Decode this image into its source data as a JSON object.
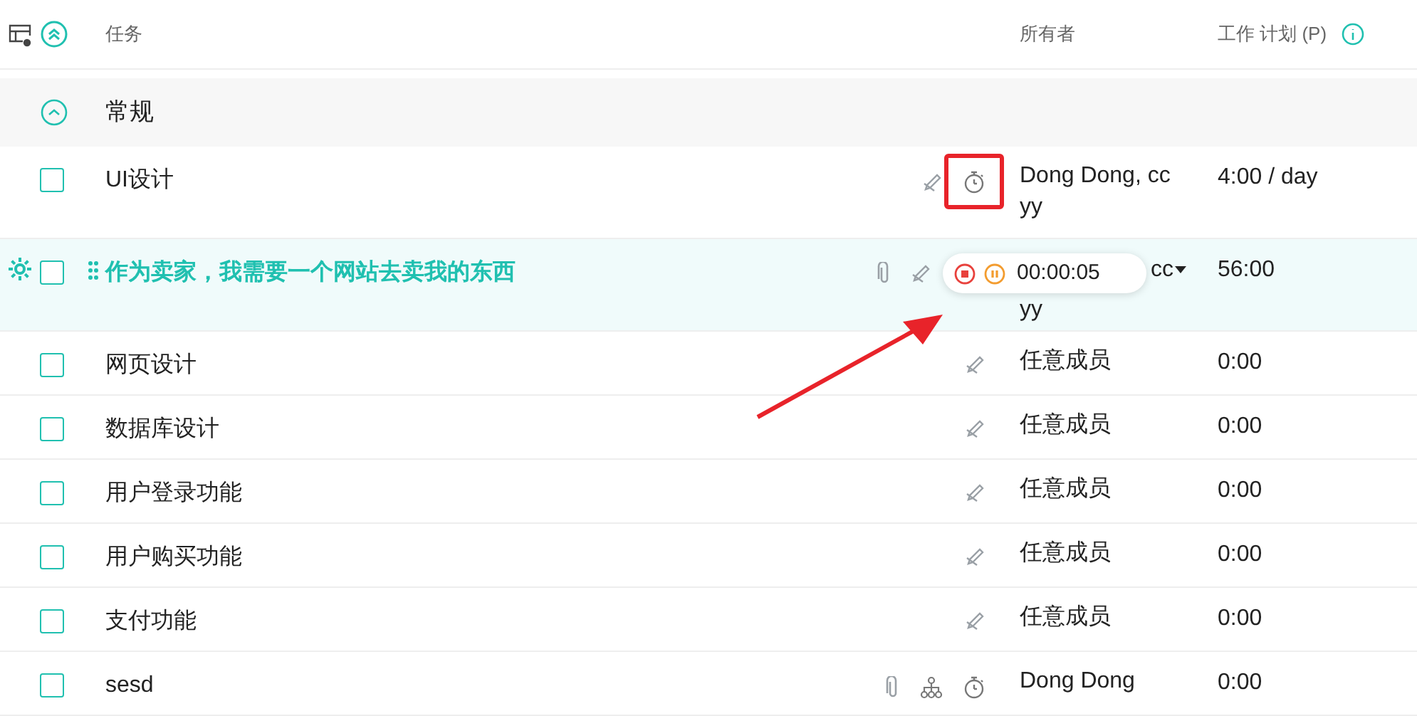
{
  "header": {
    "task": "任务",
    "owner": "所有者",
    "plan": "工作 计划 (P)"
  },
  "group": {
    "name": "常规",
    "expanded": true
  },
  "rows": [
    {
      "name": "UI设计",
      "active": false,
      "checked": false,
      "icons": [
        {
          "kind": "pen",
          "boxed": false
        },
        {
          "kind": "timer",
          "boxed": true
        }
      ],
      "owner": "Dong Dong, cc yy",
      "plan": "4:00 / day"
    },
    {
      "name": "作为卖家，我需要一个网站去卖我的东西",
      "active": true,
      "checked": false,
      "icons": [
        {
          "kind": "clip",
          "boxed": false
        },
        {
          "kind": "pen",
          "boxed": false
        }
      ],
      "owner_parts": [
        "cc",
        "yy"
      ],
      "owner_dropdown": true,
      "plan": "56:00",
      "timer": {
        "time": "00:00:05"
      }
    },
    {
      "name": "网页设计",
      "active": false,
      "checked": false,
      "icons": [
        {
          "kind": "pen",
          "boxed": false
        }
      ],
      "owner": "任意成员",
      "plan": "0:00"
    },
    {
      "name": "数据库设计",
      "active": false,
      "checked": false,
      "icons": [
        {
          "kind": "pen",
          "boxed": false
        }
      ],
      "owner": "任意成员",
      "plan": "0:00"
    },
    {
      "name": "用户登录功能",
      "active": false,
      "checked": false,
      "icons": [
        {
          "kind": "pen",
          "boxed": false
        }
      ],
      "owner": "任意成员",
      "plan": "0:00"
    },
    {
      "name": "用户购买功能",
      "active": false,
      "checked": false,
      "icons": [
        {
          "kind": "pen",
          "boxed": false
        }
      ],
      "owner": "任意成员",
      "plan": "0:00"
    },
    {
      "name": "支付功能",
      "active": false,
      "checked": false,
      "icons": [
        {
          "kind": "pen",
          "boxed": false
        }
      ],
      "owner": "任意成员",
      "plan": "0:00"
    },
    {
      "name": "sesd",
      "active": false,
      "checked": false,
      "icons": [
        {
          "kind": "clip",
          "boxed": false
        },
        {
          "kind": "tree",
          "boxed": false
        },
        {
          "kind": "timer",
          "boxed": false
        }
      ],
      "owner": "Dong Dong",
      "plan": "0:00"
    }
  ]
}
